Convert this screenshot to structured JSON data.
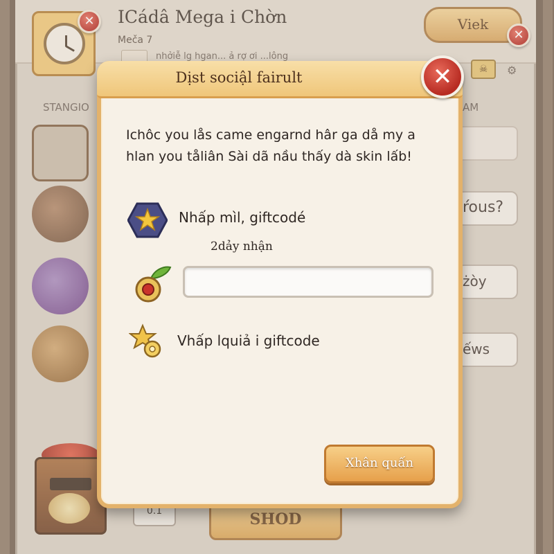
{
  "background": {
    "title": "ICádâ Mega i Chờn",
    "subtitle": "Meča 7",
    "subtext": "nhởiễ lg hgan... ả rợ ơi ...lông",
    "view_button": "Viek",
    "section_left": "STANGIO",
    "section_right": "AM",
    "side_buttons": [
      "ŕous?",
      "żòy",
      "ếws"
    ],
    "counter": "0.1",
    "shop_button": "SHOD"
  },
  "modal": {
    "title": "Dịst sociậl fairult",
    "close_glyph": "✕",
    "message": "Ichôc you lås came engarnd hâr ga då my a hlan you tåliân Sài dã nầu thấy dà skin lấb!",
    "row1_label": "Nhấp mìl, giftcodé",
    "code_hint": "2dảy nhận",
    "input_value": "",
    "input_placeholder": "",
    "row3_label": "Vhấp lquiả i giftcode",
    "confirm_button": "Xhân quấn"
  },
  "icons": {
    "modal_star": "star-badge-icon",
    "modal_fruit": "fruit-icon",
    "modal_gift": "gift-icon",
    "background_clock": "clock-icon"
  },
  "colors": {
    "modal_border": "#e3b26b",
    "modal_header": "#efc67a",
    "close_red": "#b72b22",
    "confirm_orange": "#e6a04b",
    "modal_bg": "#f7f1e7"
  }
}
